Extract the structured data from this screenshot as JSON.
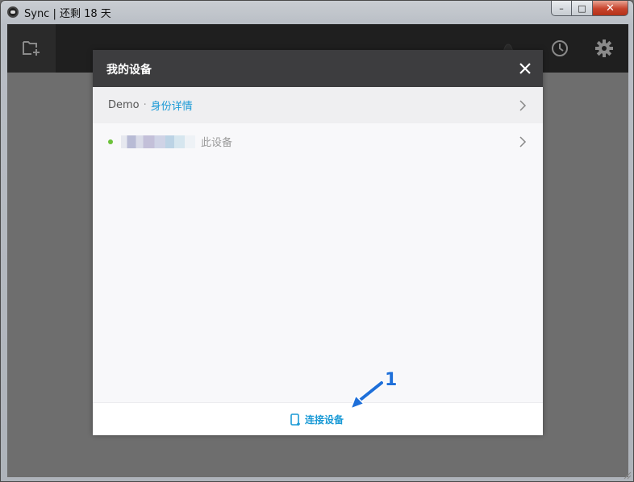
{
  "window": {
    "title": "Sync | 还剩 18 天",
    "buttons": {
      "minimize": "–",
      "maximize": "□",
      "close": "✕"
    }
  },
  "toolbar": {
    "icons": [
      "add-folder-icon",
      "history-icon",
      "settings-icon"
    ]
  },
  "modal": {
    "title": "我的设备",
    "close": "✕",
    "devices": [
      {
        "name": "Demo",
        "separator": "·",
        "link": "身份详情"
      },
      {
        "status": "online",
        "tag": "此设备"
      }
    ],
    "footer": {
      "connect_label": "连接设备"
    }
  },
  "annotation": {
    "number": "1"
  },
  "colors": {
    "accent": "#1a9ad6",
    "online": "#6cc23a",
    "header": "#3d3d3f",
    "toolbar": "#1f1f1f"
  }
}
